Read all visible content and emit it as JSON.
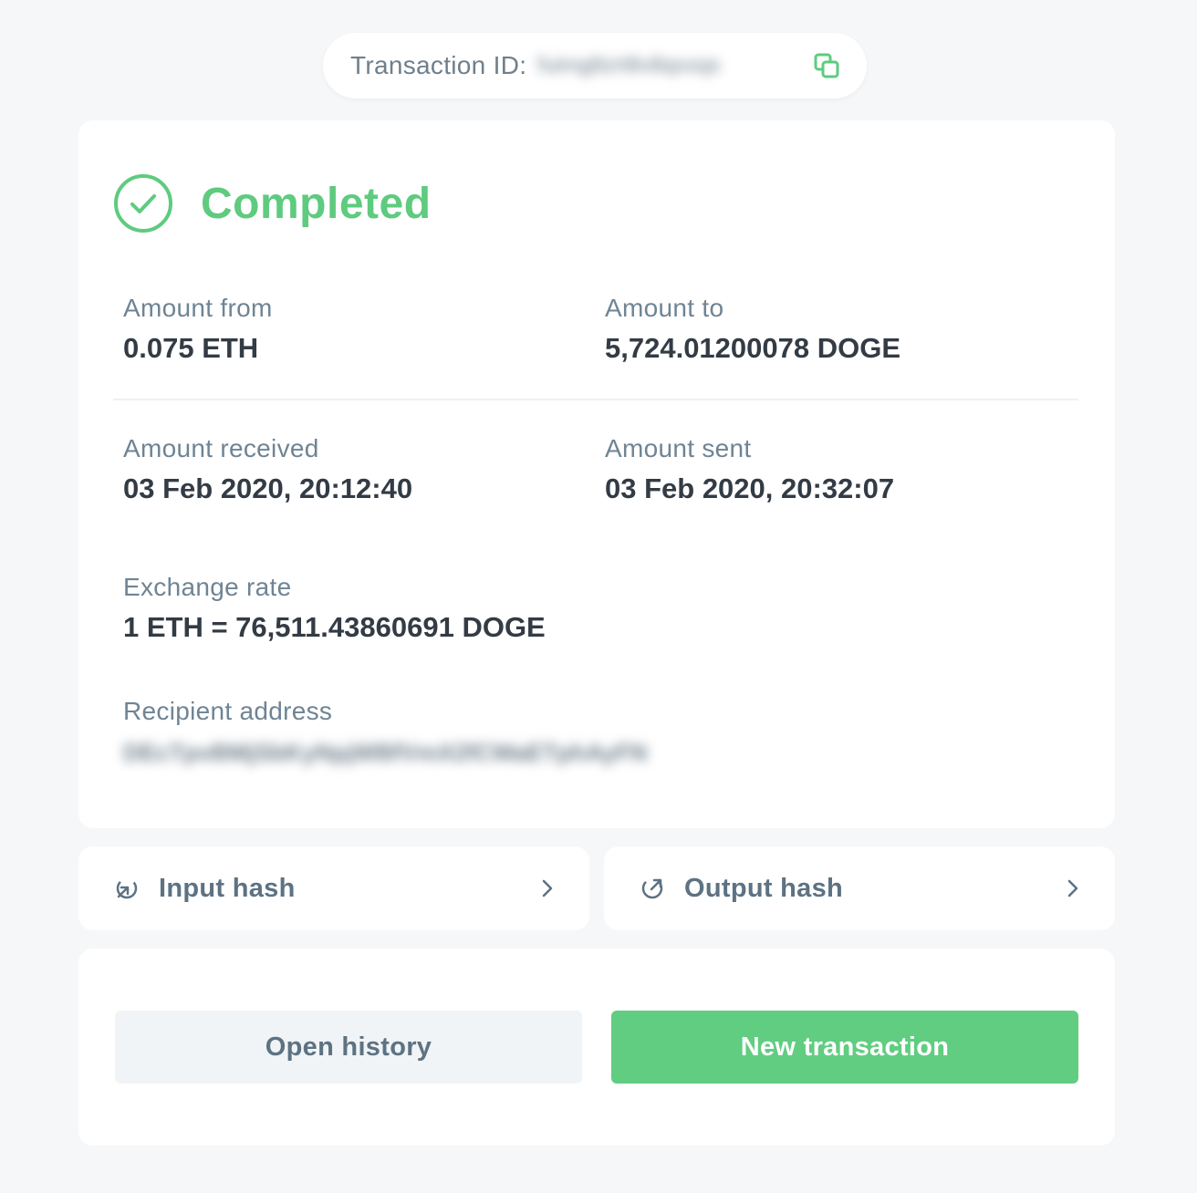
{
  "transaction_id": {
    "label": "Transaction ID:",
    "value": "fuimg8zrt8v8qxxqs",
    "copy_icon": "copy-icon"
  },
  "status": {
    "text": "Completed",
    "icon": "check-circle-icon",
    "color": "#5ecb7f"
  },
  "fields": {
    "amount_from": {
      "label": "Amount from",
      "value": "0.075 ETH"
    },
    "amount_to": {
      "label": "Amount to",
      "value": "5,724.01200078 DOGE"
    },
    "amount_received": {
      "label": "Amount received",
      "value": "03 Feb 2020, 20:12:40"
    },
    "amount_sent": {
      "label": "Amount sent",
      "value": "03 Feb 2020, 20:32:07"
    },
    "exchange_rate": {
      "label": "Exchange rate",
      "value": "1 ETH = 76,511.43860691 DOGE"
    },
    "recipient_address": {
      "label": "Recipient address",
      "value": "DEcTpvBMjSbKyNpjWBfVmX2fCWaETphAyFN"
    }
  },
  "hashes": {
    "input": {
      "label": "Input hash",
      "icon": "input-arrow-icon"
    },
    "output": {
      "label": "Output hash",
      "icon": "output-arrow-icon"
    }
  },
  "actions": {
    "open_history": "Open history",
    "new_transaction": "New transaction"
  },
  "colors": {
    "accent": "#60cd80",
    "label": "#6f8494",
    "background": "#f6f7f8"
  }
}
